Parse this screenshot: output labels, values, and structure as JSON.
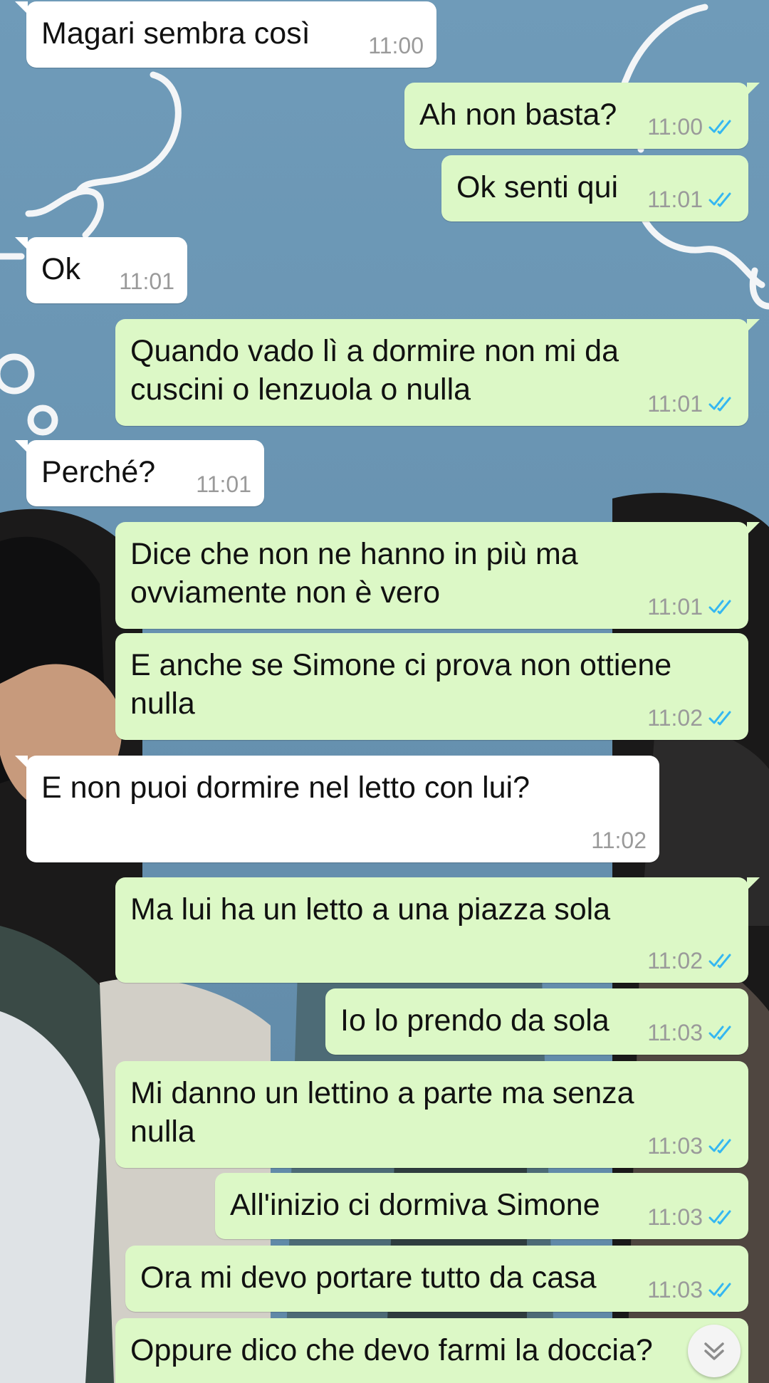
{
  "colors": {
    "incoming_bubble": "#ffffff",
    "outgoing_bubble": "#dcf8c6",
    "read_ticks": "#34b7f1",
    "time_text": "#9a9a9a"
  },
  "messages": [
    {
      "direction": "incoming",
      "text": "Magari sembra così",
      "time": "11:00"
    },
    {
      "direction": "outgoing",
      "text": "Ah non basta?",
      "time": "11:00",
      "status": "read"
    },
    {
      "direction": "outgoing",
      "text": "Ok senti qui",
      "time": "11:01",
      "status": "read"
    },
    {
      "direction": "incoming",
      "text": "Ok",
      "time": "11:01"
    },
    {
      "direction": "outgoing",
      "text": "Quando vado lì a dormire non mi da cuscini o lenzuola o nulla",
      "time": "11:01",
      "status": "read"
    },
    {
      "direction": "incoming",
      "text": "Perché?",
      "time": "11:01"
    },
    {
      "direction": "outgoing",
      "text": "Dice che non ne hanno in più ma ovviamente non è vero",
      "time": "11:01",
      "status": "read"
    },
    {
      "direction": "outgoing",
      "text": "E anche se Simone ci prova non ottiene nulla",
      "time": "11:02",
      "status": "read"
    },
    {
      "direction": "incoming",
      "text": "E non puoi dormire nel letto con lui?",
      "time": "11:02"
    },
    {
      "direction": "outgoing",
      "text": "Ma lui ha un letto a una piazza sola",
      "time": "11:02",
      "status": "read"
    },
    {
      "direction": "outgoing",
      "text": "Io lo prendo da sola",
      "time": "11:03",
      "status": "read"
    },
    {
      "direction": "outgoing",
      "text": "Mi danno un lettino a parte ma senza nulla",
      "time": "11:03",
      "status": "read"
    },
    {
      "direction": "outgoing",
      "text": "All'inizio ci dormiva Simone",
      "time": "11:03",
      "status": "read"
    },
    {
      "direction": "outgoing",
      "text": "Ora mi devo portare tutto da casa",
      "time": "11:03",
      "status": "read"
    },
    {
      "direction": "outgoing",
      "text": "Oppure dico che devo farmi la doccia?",
      "time": "",
      "status": ""
    }
  ],
  "scroll_button": {
    "icon": "double-chevron-down-icon"
  }
}
